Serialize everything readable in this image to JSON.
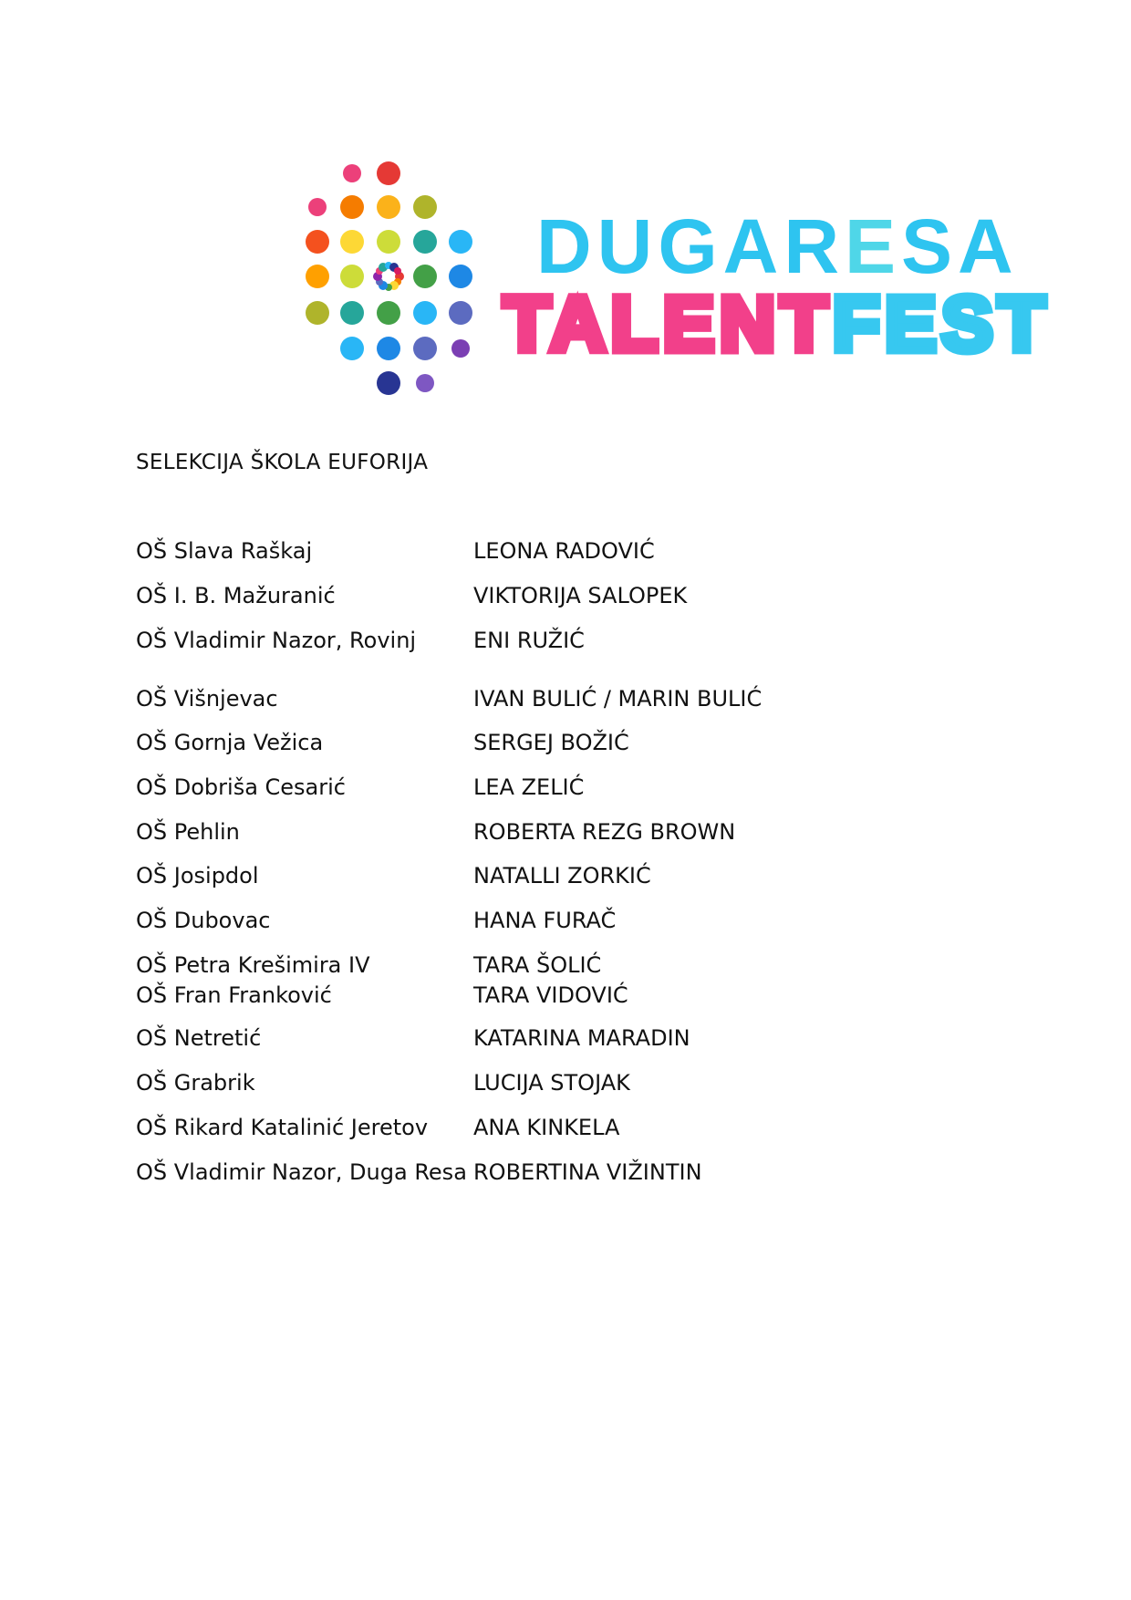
{
  "logo": {
    "line1": "DUGARESA",
    "line2": "TALENTFEST",
    "line1_color": "#2ec4f0",
    "line1_accent": "#4fd6e8",
    "line2_pink": "#f2408a",
    "line2_cyan": "#37c8f0"
  },
  "heading": "SELEKCIJA ŠKOLA EUFORIJA",
  "entries": [
    {
      "school": "OŠ Slava Raškaj",
      "student": "LEONA RADOVIĆ"
    },
    {
      "school": "OŠ I. B. Mažuranić",
      "student": "VIKTORIJA SALOPEK"
    },
    {
      "school": "OŠ Vladimir Nazor, Rovinj",
      "student": "ENI RUŽIĆ"
    },
    {
      "school": "OŠ Višnjevac",
      "student": "IVAN BULIĆ / MARIN BULIĆ"
    },
    {
      "school": "OŠ Gornja Vežica",
      "student": "SERGEJ BOŽIĆ"
    },
    {
      "school": "OŠ Dobriša Cesarić",
      "student": "LEA ZELIĆ"
    },
    {
      "school": "OŠ Pehlin",
      "student": "ROBERTA REZG BROWN"
    },
    {
      "school": " OŠ Josipdol",
      "student": "NATALLI ZORKIĆ"
    },
    {
      "school": "OŠ Dubovac",
      "student": "HANA FURAČ"
    },
    {
      "school": "OŠ Petra Krešimira IV",
      "student": "TARA ŠOLIĆ"
    },
    {
      "school": "OŠ Fran Franković",
      "student": "TARA VIDOVIĆ"
    },
    {
      "school": "OŠ Netretić",
      "student": "KATARINA MARADIN"
    },
    {
      "school": "OŠ Grabrik",
      "student": "LUCIJA STOJAK"
    },
    {
      "school": "OŠ Rikard Katalinić Jeretov",
      "student": "ANA KINKELA"
    },
    {
      "school": "OŠ Vladimir Nazor, Duga Resa",
      "student": "ROBERTINA VIŽINTIN"
    }
  ]
}
